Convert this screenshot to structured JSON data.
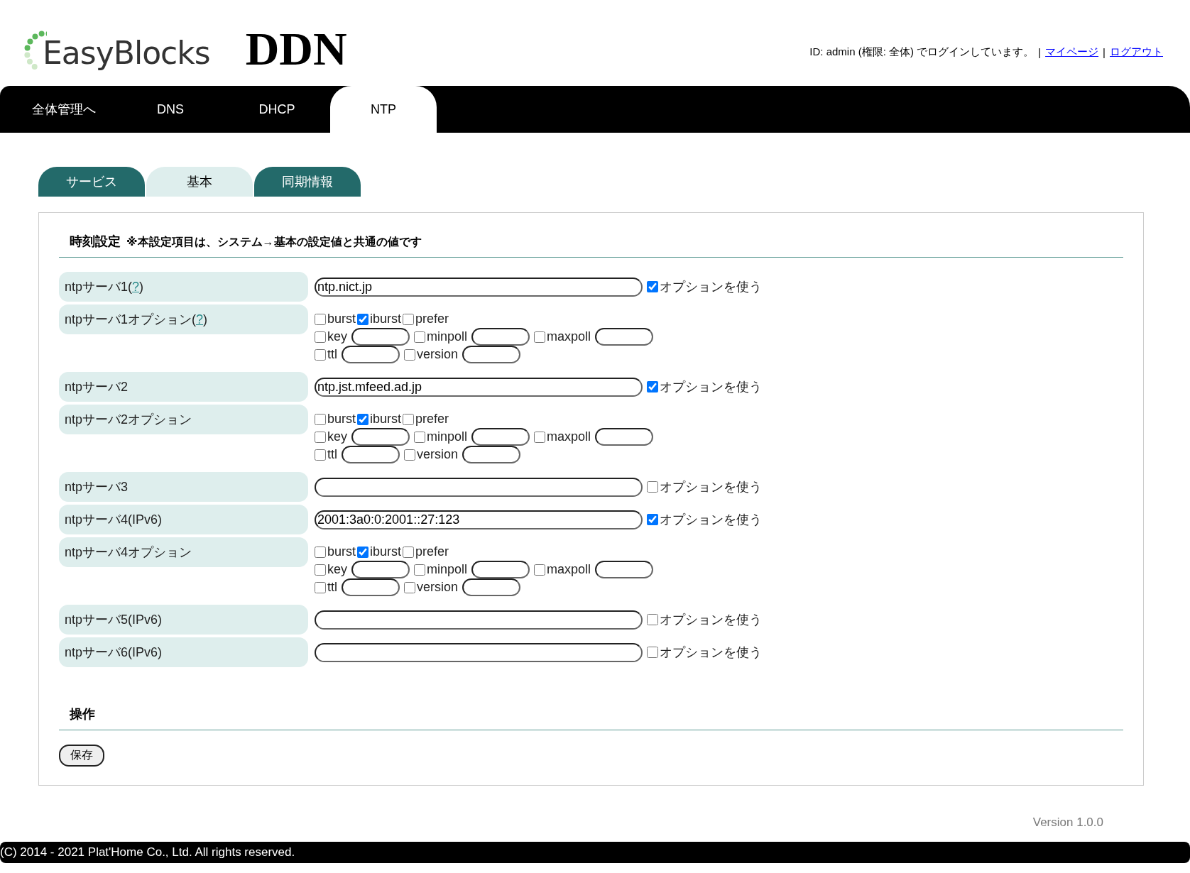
{
  "header": {
    "logo_text": "EasyBlocks",
    "product": "DDN",
    "login_text": "ID: admin (権限: 全体) でログインしています。",
    "separator_1": "|",
    "mypage_link": "マイページ",
    "separator_2": "|",
    "logout_link": "ログアウト"
  },
  "nav": [
    {
      "label": "全体管理へ",
      "selected": false
    },
    {
      "label": "DNS",
      "selected": false
    },
    {
      "label": "DHCP",
      "selected": false
    },
    {
      "label": "NTP",
      "selected": true
    }
  ],
  "sub_tabs": [
    {
      "label": "サービス",
      "selected": false
    },
    {
      "label": "基本",
      "selected": true
    },
    {
      "label": "同期情報",
      "selected": false
    }
  ],
  "section": {
    "title": "時刻設定",
    "note": "※本設定項目は、システム→基本の設定値と共通の値です"
  },
  "rows": [
    {
      "kind": "server",
      "label": "ntpサーバ1(",
      "help": "?",
      "label_end": ")",
      "value": "ntp.nict.jp",
      "option": {
        "label": "オプションを使う",
        "checked": true
      }
    },
    {
      "kind": "options",
      "label": "ntpサーバ1オプション(",
      "help": "?",
      "label_end": ")",
      "lines": [
        [
          {
            "kind": "flag",
            "label": "burst",
            "checked": false
          },
          {
            "kind": "flag",
            "label": "iburst",
            "checked": true
          },
          {
            "kind": "flag",
            "label": "prefer",
            "checked": false
          }
        ],
        [
          {
            "kind": "param",
            "label": "key",
            "checked": false
          },
          {
            "kind": "param",
            "label": "minpoll",
            "checked": false
          },
          {
            "kind": "param",
            "label": "maxpoll",
            "checked": false
          }
        ],
        [
          {
            "kind": "param",
            "label": "ttl",
            "checked": false
          },
          {
            "kind": "param",
            "label": "version",
            "checked": false
          }
        ]
      ]
    },
    {
      "kind": "server",
      "label": "ntpサーバ2",
      "value": "ntp.jst.mfeed.ad.jp",
      "option": {
        "label": "オプションを使う",
        "checked": true
      }
    },
    {
      "kind": "options",
      "label": "ntpサーバ2オプション",
      "lines": [
        [
          {
            "kind": "flag",
            "label": "burst",
            "checked": false
          },
          {
            "kind": "flag",
            "label": "iburst",
            "checked": true
          },
          {
            "kind": "flag",
            "label": "prefer",
            "checked": false
          }
        ],
        [
          {
            "kind": "param",
            "label": "key",
            "checked": false
          },
          {
            "kind": "param",
            "label": "minpoll",
            "checked": false
          },
          {
            "kind": "param",
            "label": "maxpoll",
            "checked": false
          }
        ],
        [
          {
            "kind": "param",
            "label": "ttl",
            "checked": false
          },
          {
            "kind": "param",
            "label": "version",
            "checked": false
          }
        ]
      ]
    },
    {
      "kind": "server",
      "label": "ntpサーバ3",
      "option": {
        "label": "オプションを使う",
        "checked": false
      }
    },
    {
      "kind": "server",
      "label": "ntpサーバ4(IPv6)",
      "value": "2001:3a0:0:2001::27:123",
      "option": {
        "label": "オプションを使う",
        "checked": true
      }
    },
    {
      "kind": "options",
      "label": "ntpサーバ4オプション",
      "lines": [
        [
          {
            "kind": "flag",
            "label": "burst",
            "checked": false
          },
          {
            "kind": "flag",
            "label": "iburst",
            "checked": true
          },
          {
            "kind": "flag",
            "label": "prefer",
            "checked": false
          }
        ],
        [
          {
            "kind": "param",
            "label": "key",
            "checked": false
          },
          {
            "kind": "param",
            "label": "minpoll",
            "checked": false
          },
          {
            "kind": "param",
            "label": "maxpoll",
            "checked": false
          }
        ],
        [
          {
            "kind": "param",
            "label": "ttl",
            "checked": false
          },
          {
            "kind": "param",
            "label": "version",
            "checked": false
          }
        ]
      ]
    },
    {
      "kind": "server",
      "label": "ntpサーバ5(IPv6)",
      "option": {
        "label": "オプションを使う",
        "checked": false
      }
    },
    {
      "kind": "server",
      "label": "ntpサーバ6(IPv6)",
      "option": {
        "label": "オプションを使う",
        "checked": false
      }
    }
  ],
  "operations": {
    "title": "操作",
    "save_button": "保存"
  },
  "version": "Version 1.0.0",
  "footer": "(C) 2014 - 2021 Plat'Home Co., Ltd. All rights reserved."
}
